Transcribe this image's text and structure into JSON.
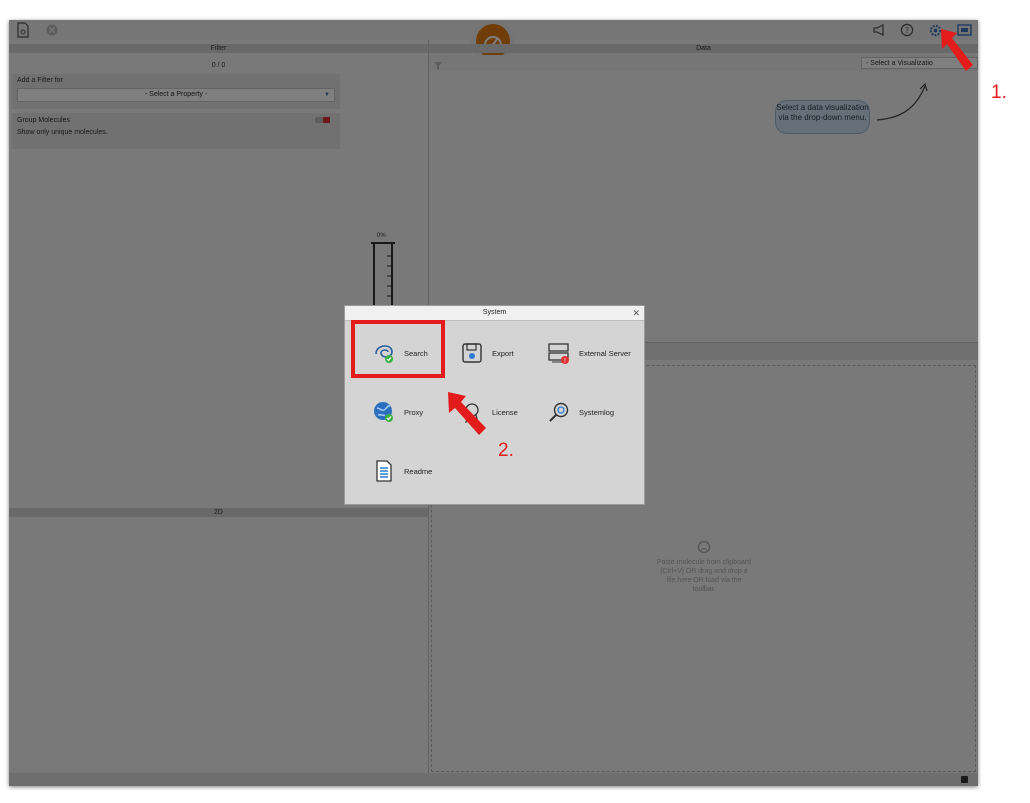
{
  "panels": {
    "filter": {
      "title": "Filter",
      "count": "0 / 0",
      "add_filter_label": "Add a Filter for",
      "select_property": "- Select a Property -",
      "group_title": "Group Molecules",
      "group_desc": "Show only unique molecules."
    },
    "data": {
      "title": "Data",
      "select_visualization": "- Select a Visualizatio",
      "bubble_text": "Select a data visualization via the drop-down menu."
    },
    "progress": {
      "label": "0%"
    },
    "twod": {
      "title": "2D"
    },
    "dropzone": {
      "text": "Paste molecule from clipboard [Ctrl+V] OR drag and drop a file here OR load via the toolbar."
    }
  },
  "dialog": {
    "title": "System",
    "items": [
      {
        "label": "Search",
        "icon": "search-settings-icon"
      },
      {
        "label": "Export",
        "icon": "floppy-disk-icon"
      },
      {
        "label": "External Server",
        "icon": "server-icon"
      },
      {
        "label": "Proxy",
        "icon": "globe-icon"
      },
      {
        "label": "License",
        "icon": "license-icon"
      },
      {
        "label": "Systemlog",
        "icon": "magnifier-log-icon"
      },
      {
        "label": "Readme",
        "icon": "document-icon"
      }
    ]
  },
  "annotations": {
    "step1": "1.",
    "step2": "2."
  },
  "colors": {
    "accent_orange": "#e07b10",
    "highlight_red": "#e31b1b",
    "status_green": "#3cb043"
  }
}
